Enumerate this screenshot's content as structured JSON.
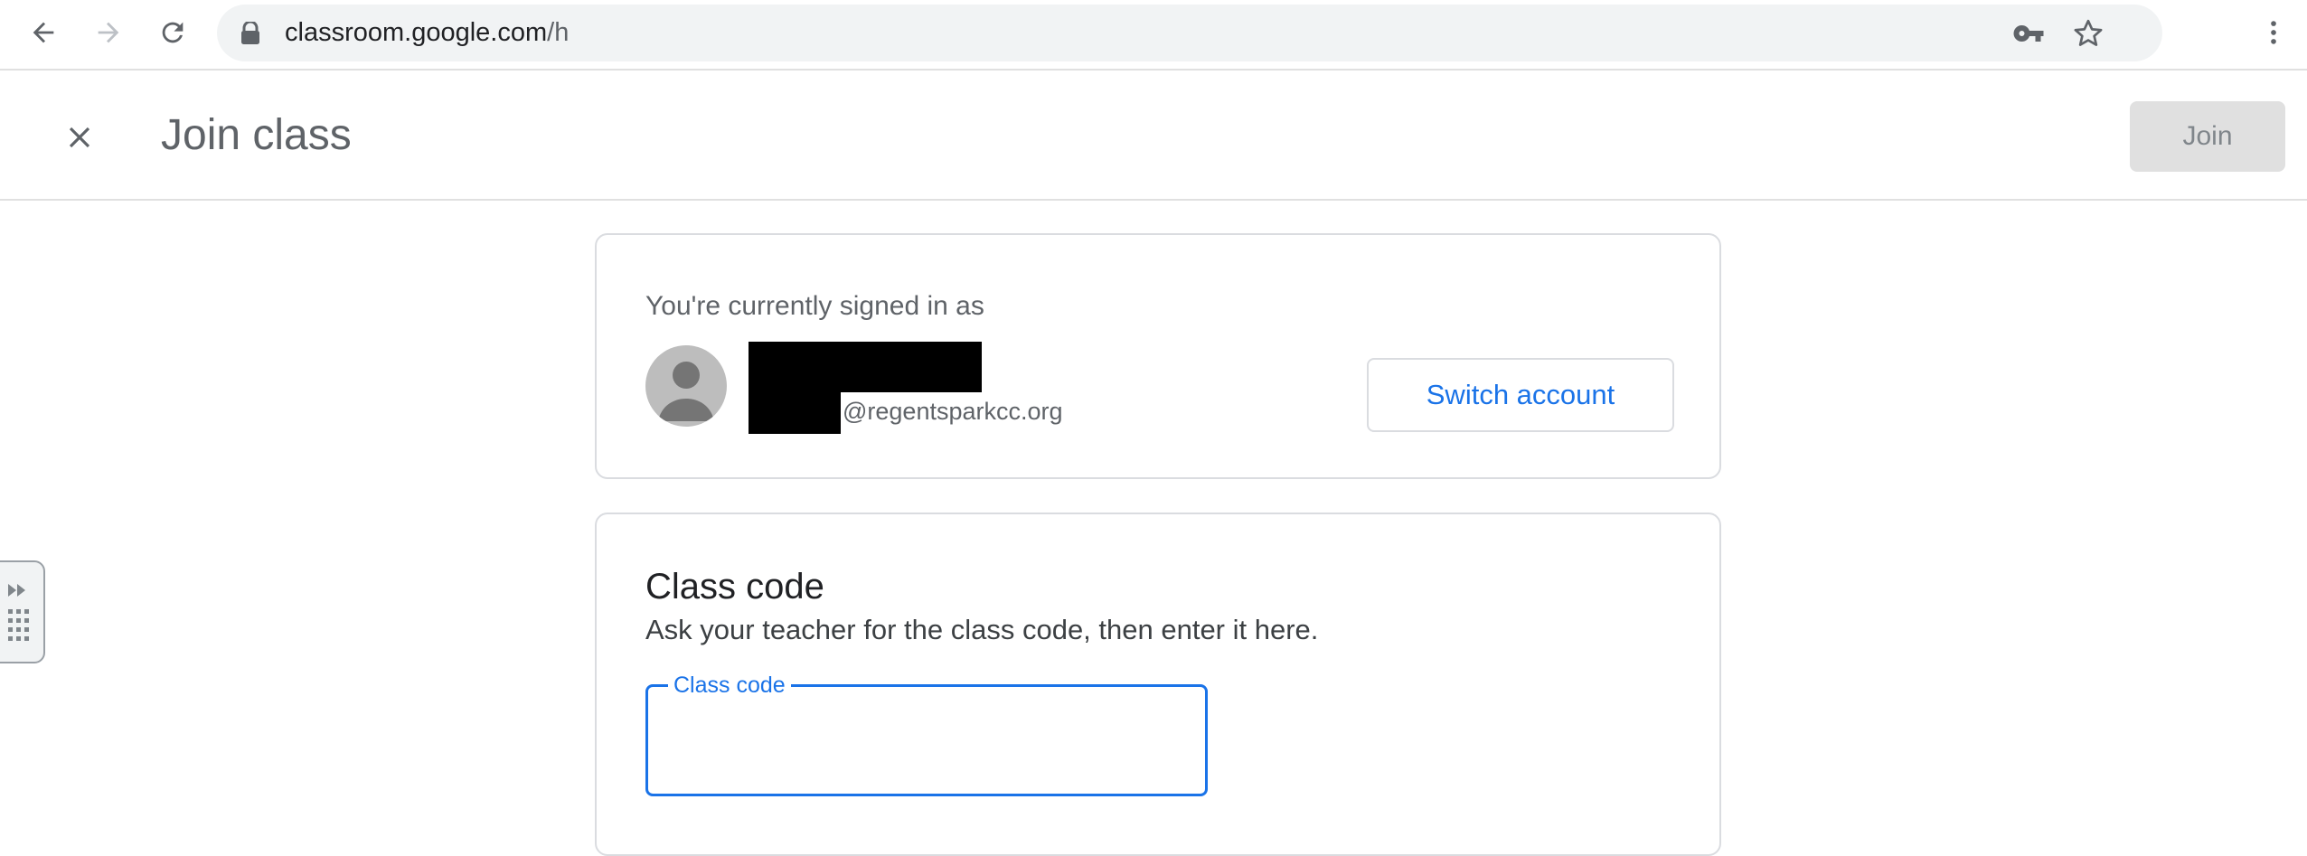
{
  "browser": {
    "url_host": "classroom.google.com",
    "url_path": "/h",
    "icons": [
      "back-arrow-icon",
      "forward-arrow-icon",
      "reload-icon",
      "lock-icon",
      "key-icon",
      "star-icon",
      "more-vert-icon"
    ]
  },
  "header": {
    "title": "Join class",
    "join_label": "Join",
    "close_icon": "close-icon"
  },
  "account": {
    "label": "You're currently signed in as",
    "email_domain": "@regentsparkcc.org",
    "switch_label": "Switch account",
    "avatar_icon": "person-icon"
  },
  "class_code": {
    "heading": "Class code",
    "description": "Ask your teacher for the class code, then enter it here.",
    "field_label": "Class code",
    "value": ""
  },
  "colors": {
    "accent": "#1a73e8",
    "text_secondary": "#5f6368",
    "border": "#dadce0",
    "disabled_bg": "#e0e0e0"
  }
}
